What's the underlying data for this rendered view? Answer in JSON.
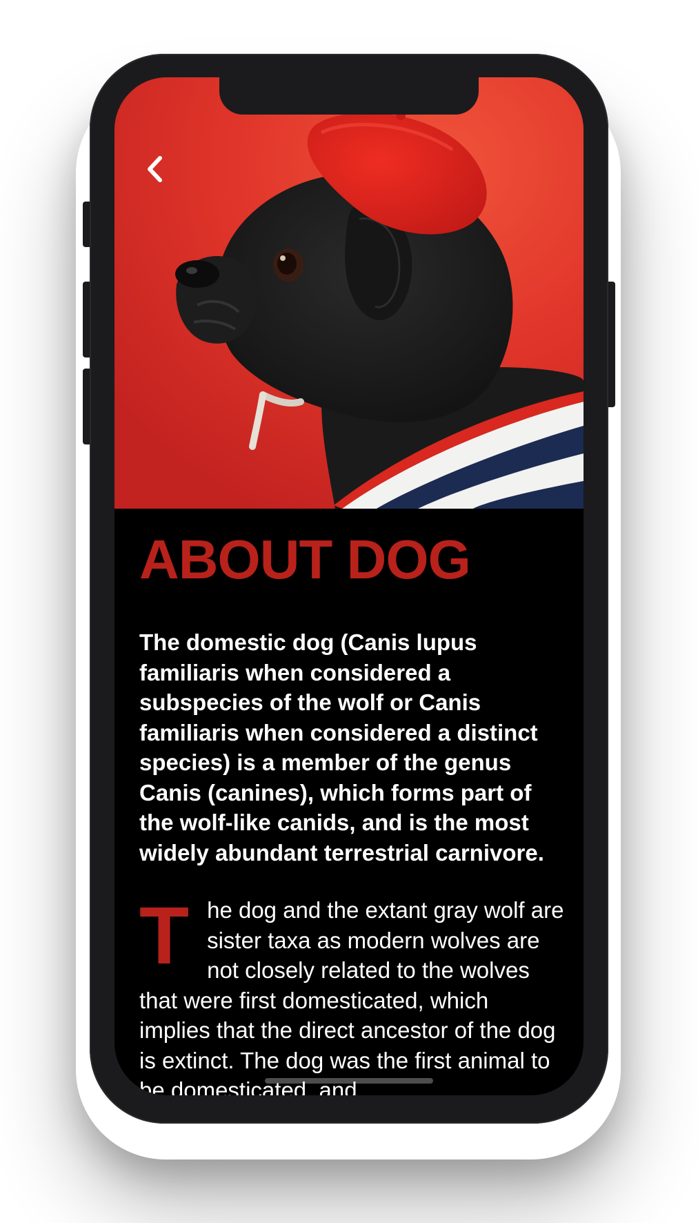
{
  "article": {
    "title": "ABOUT DOG",
    "intro": "The domestic dog (Canis lupus familiaris when considered a subspecies of the wolf or Canis familiaris when considered a distinct species)  is a member of the genus Canis (canines), which forms part of the wolf-like canids, and is the most widely abundant terrestrial carnivore.",
    "dropcap": "T",
    "body": "he dog and the extant gray wolf are sister taxa as modern wolves are not closely related to the wolves that were first domesticated, which implies that the direct ancestor of the dog is extinct.  The dog was the first animal to be domesticated, and"
  },
  "nav": {
    "back_icon": "chevron-left-icon"
  },
  "hero": {
    "image": "pug-in-red-beret-photo"
  },
  "colors": {
    "accent": "#b8221b",
    "background": "#000000",
    "text": "#ffffff",
    "hero_background": "#e2362a",
    "device_frame": "#1b1b1d"
  }
}
